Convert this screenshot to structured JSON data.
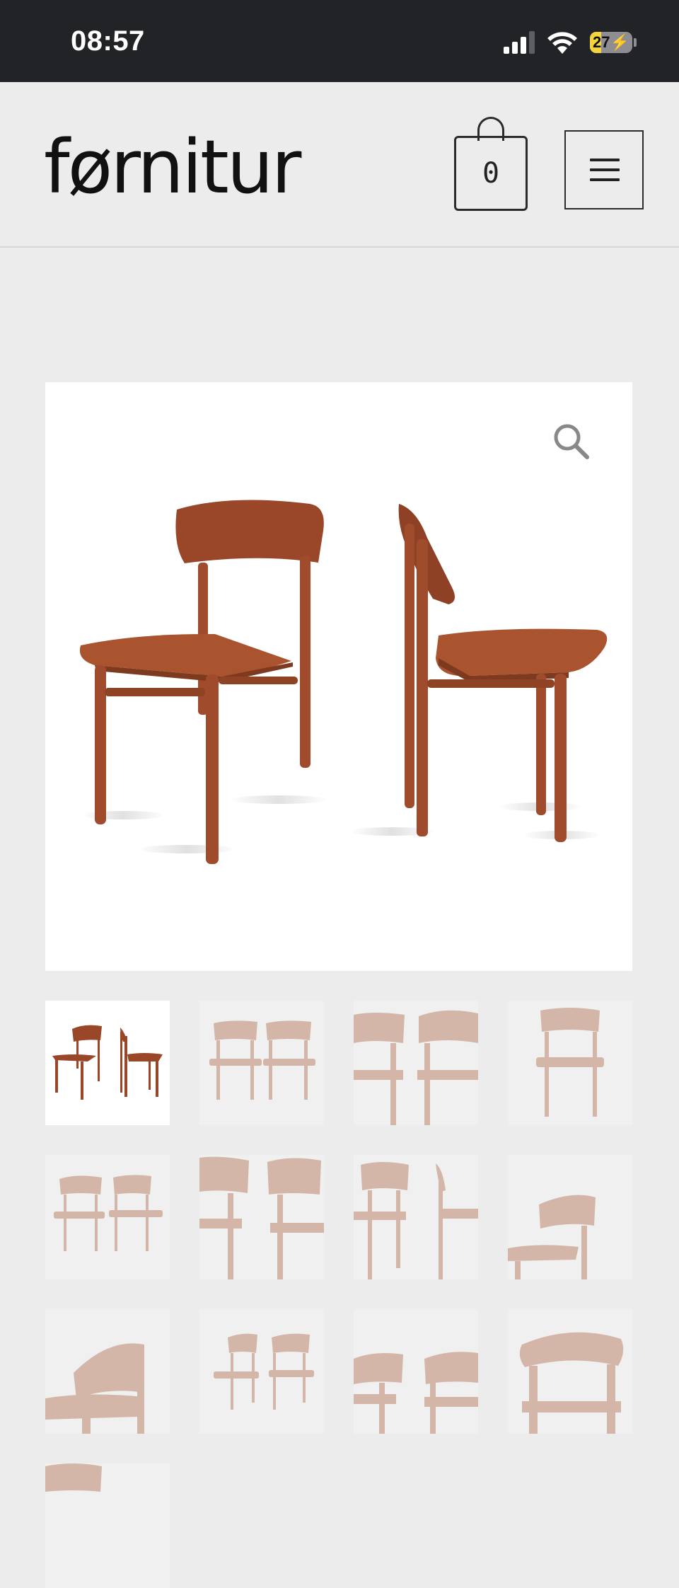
{
  "status_bar": {
    "time": "08:57",
    "battery_level": "27",
    "battery_fraction": 0.27,
    "icons": [
      "signal-icon",
      "wifi-icon",
      "battery-charging-icon"
    ]
  },
  "header": {
    "logo_text": "førnitur",
    "cart_count": "0",
    "menu_icon": "hamburger-menu-icon"
  },
  "gallery": {
    "zoom_icon": "magnifier-icon",
    "main_image": "product-image-two-chairs",
    "thumbnail_count": 13,
    "active_thumbnail": 1
  },
  "colors": {
    "status_bar_bg": "#222327",
    "page_bg": "#ececec",
    "teak": "#a04c2c",
    "battery_fill": "#f5d33a"
  }
}
